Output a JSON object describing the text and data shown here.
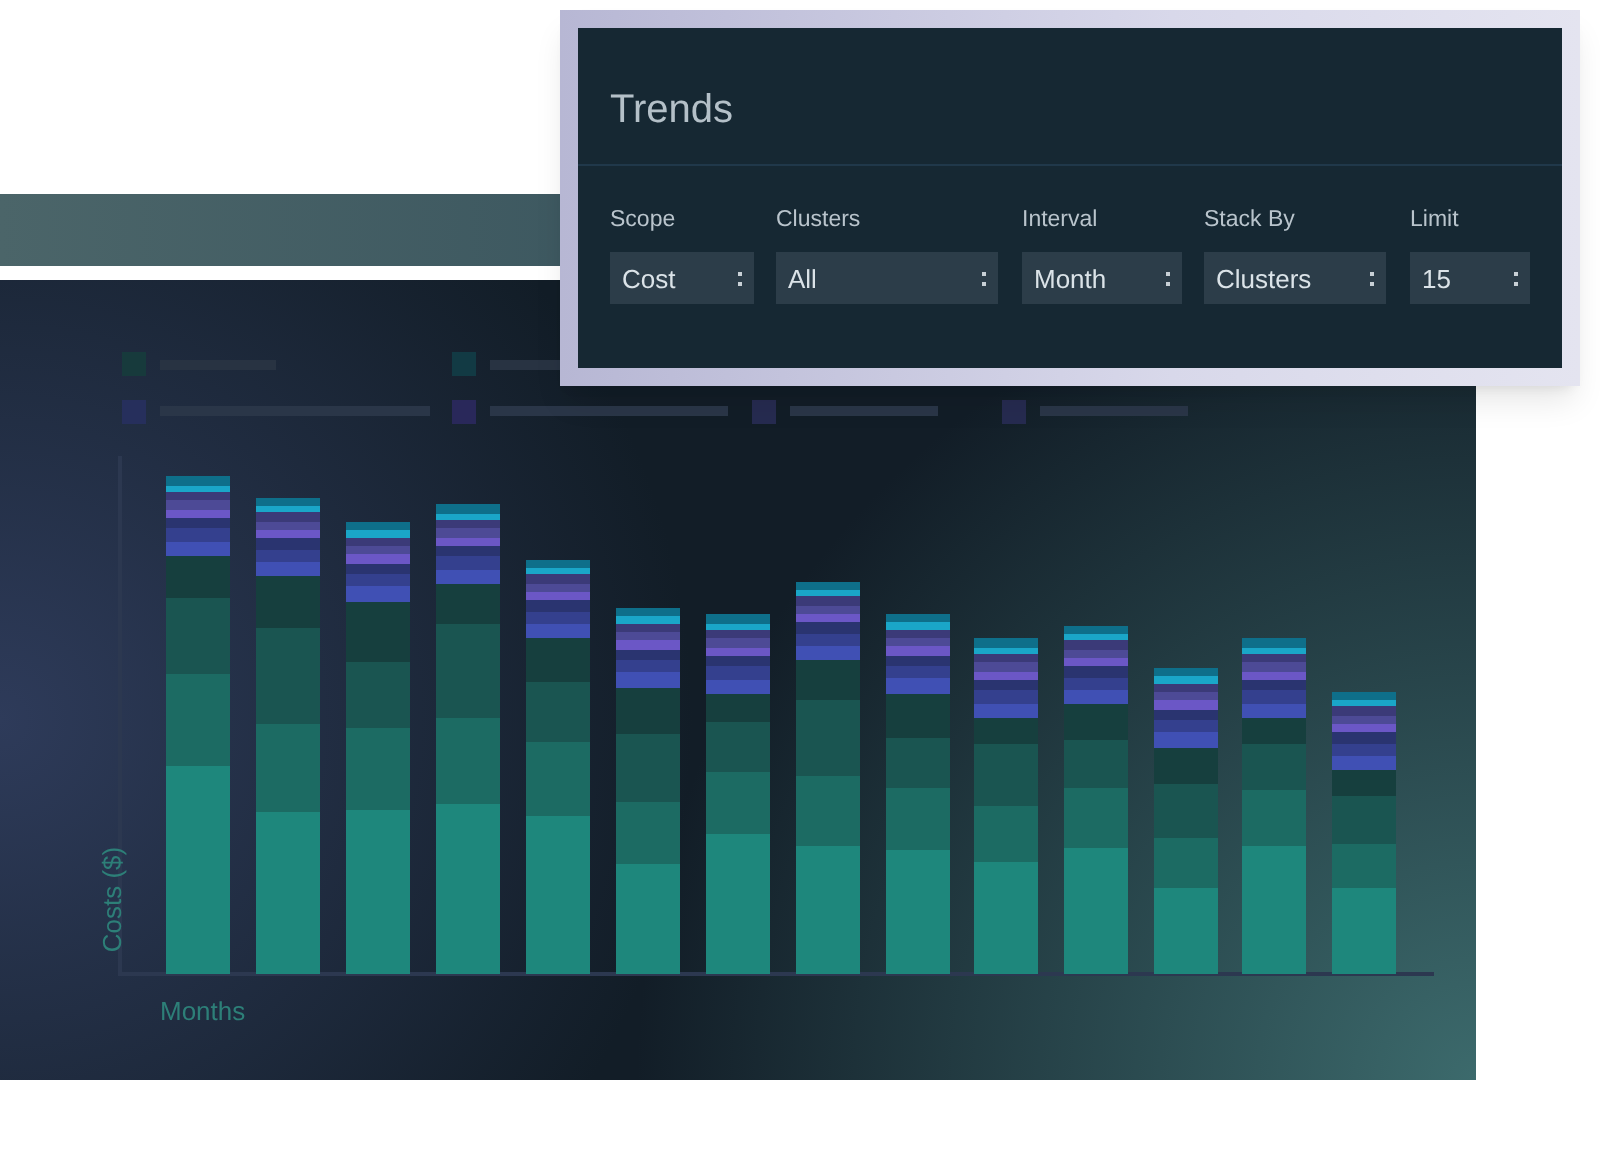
{
  "trends": {
    "title": "Trends",
    "filters": [
      {
        "label": "Scope",
        "value": "Cost"
      },
      {
        "label": "Clusters",
        "value": "All"
      },
      {
        "label": "Interval",
        "value": "Month"
      },
      {
        "label": "Stack By",
        "value": "Clusters"
      },
      {
        "label": "Limit",
        "value": "15"
      }
    ]
  },
  "chart": {
    "ylabel": "Costs ($)",
    "xlabel": "Months"
  }
}
